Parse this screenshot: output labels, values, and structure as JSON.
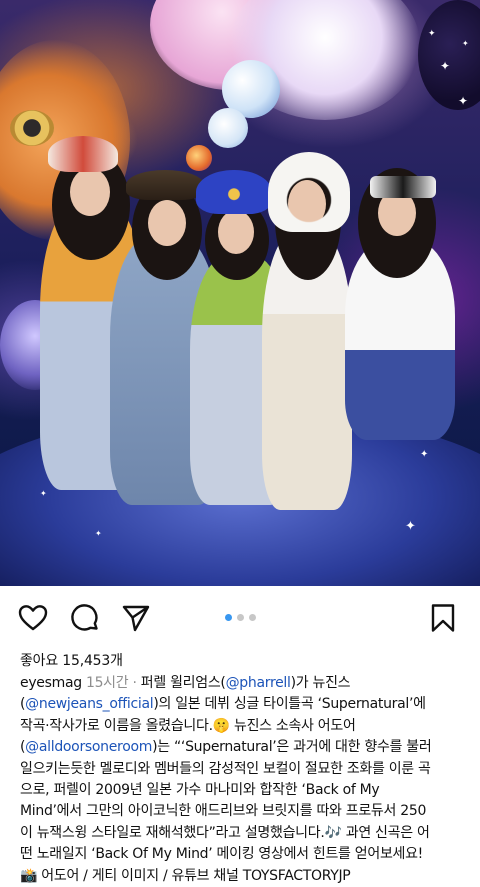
{
  "post": {
    "image_alt": "",
    "carousel": {
      "count": 3,
      "active_index": 0
    }
  },
  "actions": {
    "like": "heart-icon",
    "comment": "comment-icon",
    "share": "share-icon",
    "save": "bookmark-icon",
    "colors": {
      "active_dot": "#3897f0",
      "inactive_dot": "#c7c7c7",
      "mention": "#1d54b8"
    }
  },
  "likes": {
    "text": "좋아요 15,453개"
  },
  "caption": {
    "username": "eyesmag",
    "time": "15시간",
    "sep": " · ",
    "segments": {
      "l1_a": "퍼렐 윌리엄스(",
      "l1_mention": "@pharrell",
      "l1_b": ")가 뉴진스",
      "l2_open": "(",
      "l2_mention": "@newjeans_official",
      "l2_b": ")의 일본 데뷔 싱글 타이틀곡 ‘Supernatural’에",
      "l3": "작곡·작사가로 이름을 올렸습니다.🤫 뉴진스 소속사 어도어",
      "l4_open": "(",
      "l4_mention": "@alldoorsoneroom",
      "l4_b": ")는 “‘Supernatural’은 과거에 대한 향수를 불러",
      "l5": "일으키는듯한 멜로디와 멤버들의 감성적인 보컬이 절묘한 조화를 이룬 곡",
      "l6": "으로, 퍼렐이 2009년 일본 가수 마나미와 합작한 ‘Back of My",
      "l7": "Mind’에서 그만의 아이코닉한 애드리브와 브릿지를 따와 프로듀서 250",
      "l8": "이 뉴잭스윙 스타일로 재해석했다”라고 설명했습니다.🎶 과연 신곡은 어",
      "l9": "떤 노래일지 ‘Back Of My Mind’ 메이킹 영상에서 힌트를 얻어보세요!",
      "l10": "📸 어도어 / 게티 이미지 / 유튜브 채널 TOYSFACTORYJP"
    }
  }
}
